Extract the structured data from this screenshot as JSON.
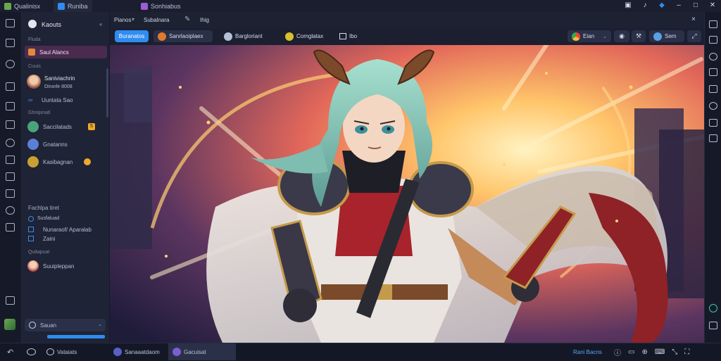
{
  "tabs": [
    {
      "label": "Qualinisx",
      "active": false
    },
    {
      "label": "Runiba",
      "active": true
    },
    {
      "label": "Sonhiabus",
      "active": false
    }
  ],
  "window_controls": [
    "window-copy",
    "volume",
    "badge",
    "minimize",
    "maximize",
    "close"
  ],
  "sidebar": {
    "header": "Kaouts",
    "section1": "Fluda",
    "highlight_item": "Saul Alancs",
    "section2": "Cuuis",
    "user_name": "Saniviachrin",
    "user_sub": "Dinorle 8008",
    "link": "Uuntata Sao",
    "section3": "Ghnipinatl",
    "contacts": [
      {
        "name": "Saccilatads",
        "color": "#4aa37a"
      },
      {
        "name": "Gnatanns",
        "color": "#5b7fd6"
      },
      {
        "name": "Kasibagnan",
        "color": "#c9a133"
      }
    ],
    "section4": "Fachlpa tiret",
    "sub4": "Susfaluad",
    "checklist": [
      "Nunaraof/ Aparalab",
      "Zaini"
    ],
    "section5": "Quitapuat",
    "last_contact": "Suuipleppan",
    "bottom_select": "Sauan"
  },
  "header": {
    "crumb1": "Pianos",
    "crumb2": "Subalnara",
    "crumb3": "Ihig",
    "close": "×"
  },
  "toolbar": {
    "primary": "Buranatos",
    "item1": "Sanrlaoiplaex",
    "item2": "Bargloriant",
    "item3": "Comglatax",
    "item4": "Ibo",
    "right_select": "Eian",
    "right_item": "Sem"
  },
  "taskbar": {
    "left_label": "Vataiats",
    "app1": "Sanaaatdaom",
    "app2": "Gacuisat",
    "right_label": "Rani Bacns"
  },
  "colors": {
    "accent": "#2f8cf0",
    "highlight": "#4b2a4f",
    "background": "#161a2a"
  }
}
